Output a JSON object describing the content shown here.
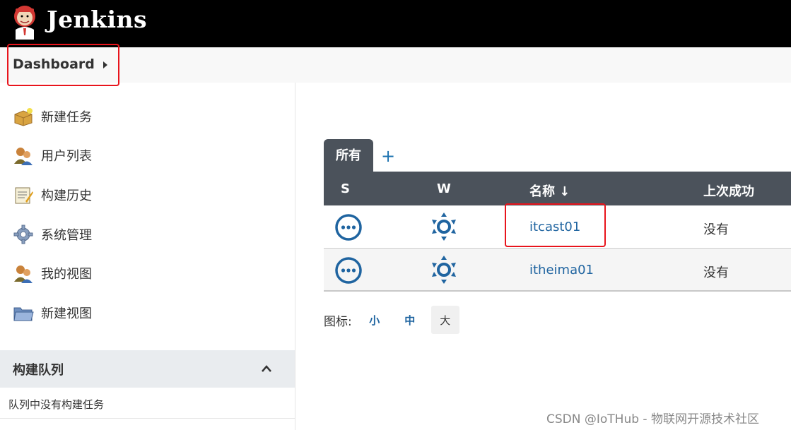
{
  "header": {
    "brand": "Jenkins",
    "logo_icon": "jenkins-butler-logo"
  },
  "breadcrumb": {
    "label": "Dashboard"
  },
  "sidebar": {
    "tasks": [
      {
        "label": "新建任务",
        "icon": "new-item-icon"
      },
      {
        "label": "用户列表",
        "icon": "users-icon"
      },
      {
        "label": "构建历史",
        "icon": "build-history-icon"
      },
      {
        "label": "系统管理",
        "icon": "gear-icon"
      },
      {
        "label": "我的视图",
        "icon": "my-views-icon"
      },
      {
        "label": "新建视图",
        "icon": "folder-icon"
      }
    ],
    "queue": {
      "title": "构建队列",
      "empty_text": "队列中没有构建任务"
    }
  },
  "main": {
    "tabs": [
      {
        "label": "所有",
        "active": true
      }
    ],
    "add_tab_label": "+",
    "columns": {
      "s": "S",
      "w": "W",
      "name": "名称 ↓",
      "last_success": "上次成功"
    },
    "jobs": [
      {
        "name": "itcast01",
        "last_success": "没有",
        "status": "not-built",
        "weather": "sunny"
      },
      {
        "name": "itheima01",
        "last_success": "没有",
        "status": "not-built",
        "weather": "sunny"
      }
    ],
    "icon_size": {
      "caption": "图标:",
      "options": [
        "小",
        "中",
        "大"
      ],
      "selected": "大"
    }
  },
  "watermark": "CSDN @IoTHub - 物联网开源技术社区",
  "colors": {
    "header_bg": "#000000",
    "table_header_bg": "#4b525b",
    "link": "#1f64a0",
    "highlight": "#e8141c"
  }
}
